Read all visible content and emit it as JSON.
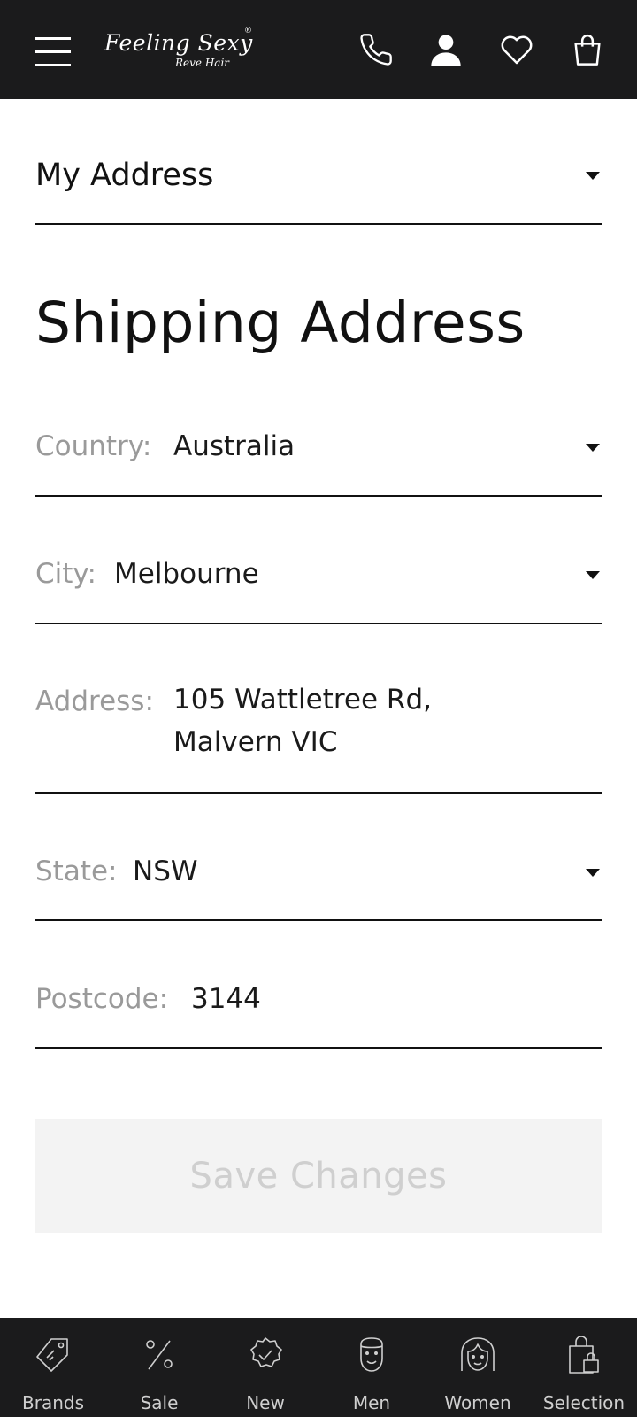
{
  "header": {
    "logo": {
      "main": "Feeling Sexy",
      "sub": "Reve Hair",
      "reg": "®"
    },
    "icons": [
      "menu-icon",
      "phone-icon",
      "user-icon",
      "heart-icon",
      "bag-icon"
    ]
  },
  "section_dropdown": {
    "label": "My Address"
  },
  "page_title": "Shipping Address",
  "form": {
    "country": {
      "label": "Country:",
      "value": "Australia"
    },
    "city": {
      "label": "City:",
      "value": "Melbourne"
    },
    "address": {
      "label": "Address:",
      "line1": "105 Wattletree Rd,",
      "line2": "Malvern VIC"
    },
    "state": {
      "label": "State:",
      "value": "NSW"
    },
    "postcode": {
      "label": "Postcode:",
      "value": "3144"
    }
  },
  "save_button": {
    "label": "Save Changes"
  },
  "bottom_nav": [
    {
      "label": "Brands",
      "icon": "tag-icon"
    },
    {
      "label": "Sale",
      "icon": "percent-icon"
    },
    {
      "label": "New",
      "icon": "badge-check-icon"
    },
    {
      "label": "Men",
      "icon": "man-face-icon"
    },
    {
      "label": "Women",
      "icon": "woman-face-icon"
    },
    {
      "label": "Selection",
      "icon": "shopping-bag-lock-icon"
    }
  ],
  "colors": {
    "header_bg": "#1b1b1c",
    "label_gray": "#9a9a9a",
    "button_bg": "#f3f3f3",
    "button_text": "#cfcfcf"
  }
}
